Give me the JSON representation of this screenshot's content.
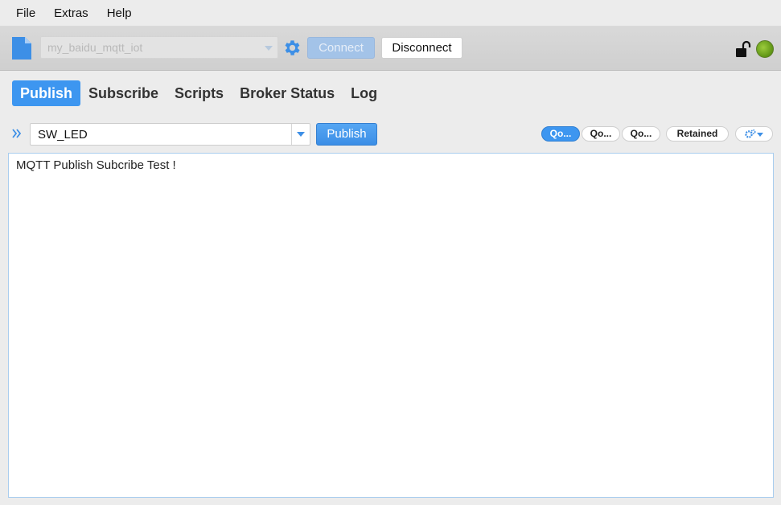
{
  "menu": {
    "items": [
      "File",
      "Extras",
      "Help"
    ]
  },
  "toolbar": {
    "profile_name": "my_baidu_mqtt_iot",
    "connect_label": "Connect",
    "disconnect_label": "Disconnect",
    "status_color": "#6aa11c"
  },
  "tabs": [
    {
      "label": "Publish",
      "active": true
    },
    {
      "label": "Subscribe",
      "active": false
    },
    {
      "label": "Scripts",
      "active": false
    },
    {
      "label": "Broker Status",
      "active": false
    },
    {
      "label": "Log",
      "active": false
    }
  ],
  "publish": {
    "topic": "SW_LED",
    "publish_label": "Publish",
    "qos_buttons": [
      "Qo...",
      "Qo...",
      "Qo..."
    ],
    "qos_selected_index": 0,
    "retained_label": "Retained",
    "message": "MQTT Publish Subcribe Test !"
  },
  "colors": {
    "accent": "#3d96f0",
    "connected": "#6aa11c"
  }
}
